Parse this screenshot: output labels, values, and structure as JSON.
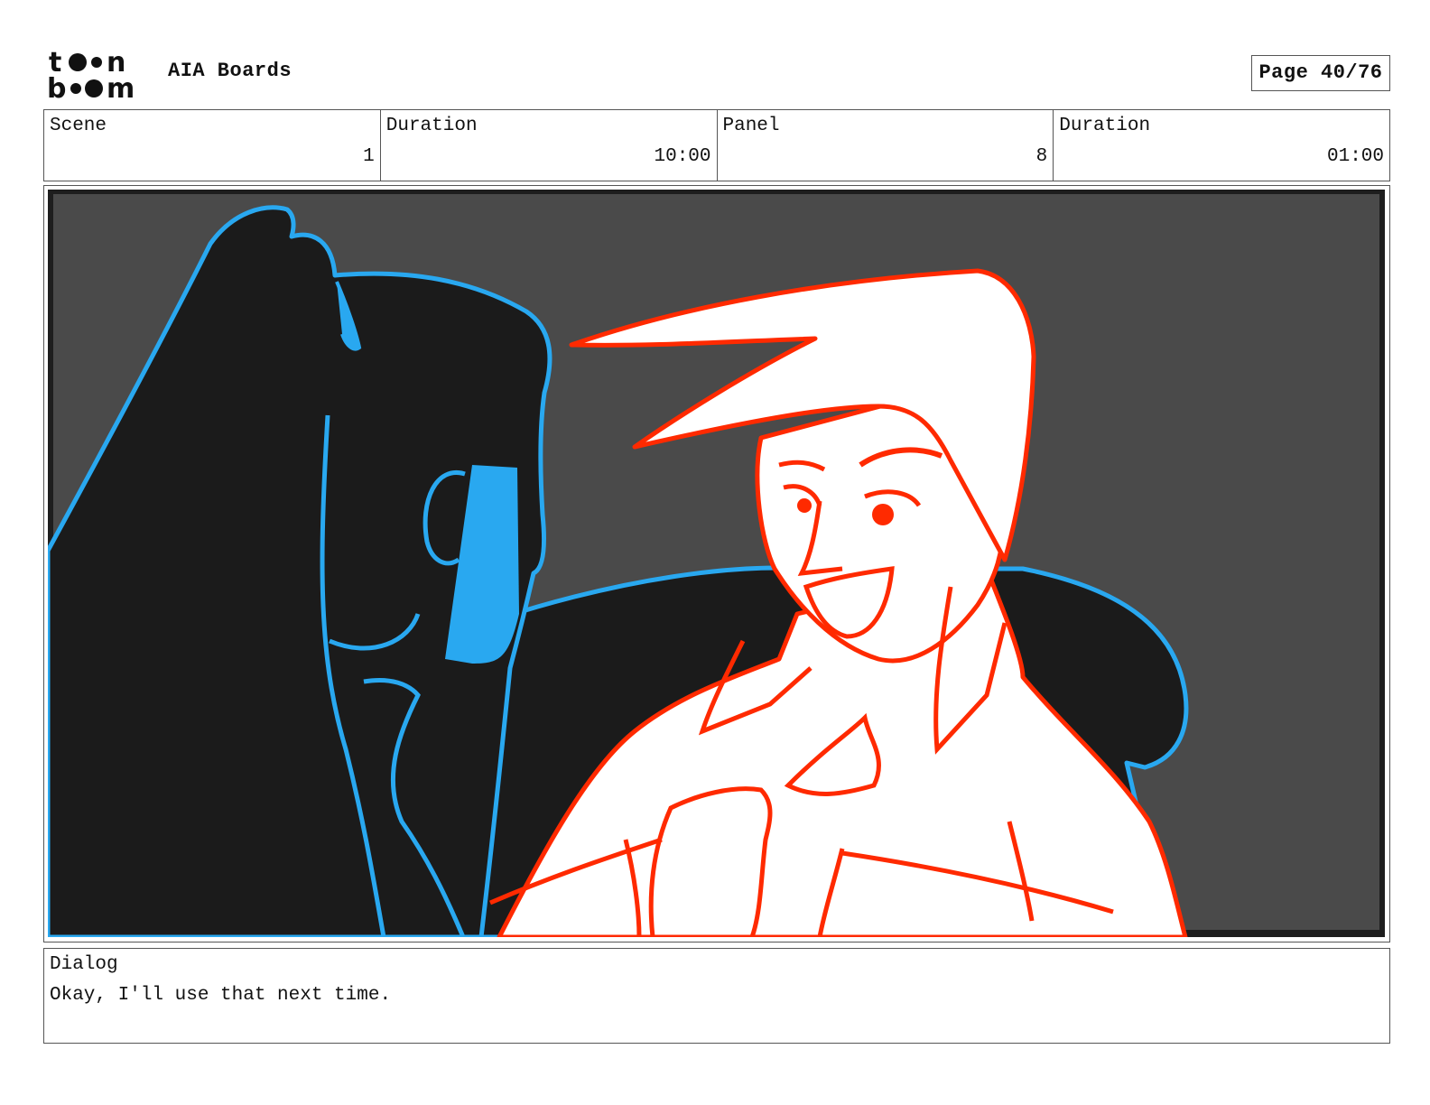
{
  "header": {
    "logo_text": "toon boom",
    "project_title": "AIA Boards",
    "page_label": "Page 40/76"
  },
  "info": {
    "scene_label": "Scene",
    "scene_value": "1",
    "scene_duration_label": "Duration",
    "scene_duration_value": "10:00",
    "panel_label": "Panel",
    "panel_value": "8",
    "panel_duration_label": "Duration",
    "panel_duration_value": "01:00"
  },
  "dialog": {
    "label": "Dialog",
    "text": "Okay, I'll use that next time."
  },
  "colors": {
    "background_gray": "#4a4a4a",
    "silhouette_black": "#1b1b1b",
    "blue_line": "#29a8f0",
    "red_line": "#ff2a00"
  }
}
